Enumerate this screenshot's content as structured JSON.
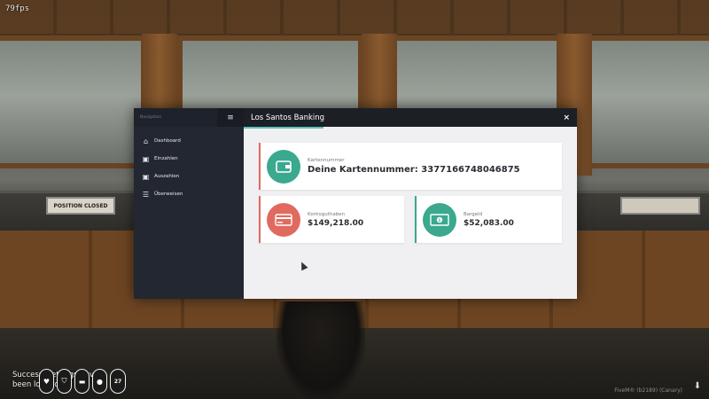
{
  "hud": {
    "fps": "79fps",
    "notification": "Success, settings have been loaded",
    "status_icons": [
      "heart-icon",
      "shield-icon",
      "burger-icon",
      "drop-icon"
    ],
    "status_number": "27",
    "watermark": "FiveM® (b2189) (Canary)"
  },
  "scene": {
    "sign_text": "POSITION CLOSED"
  },
  "modal": {
    "sidebar_title": "Navigation",
    "menu_icon": "hamburger-icon",
    "nav": [
      {
        "label": "Dashboard",
        "icon": "home-icon"
      },
      {
        "label": "Einzahlen",
        "icon": "money-in-icon"
      },
      {
        "label": "Auszahlen",
        "icon": "money-out-icon"
      },
      {
        "label": "Überweisen",
        "icon": "transfer-icon"
      }
    ],
    "title": "Los Santos Banking",
    "close": "×",
    "card_number": {
      "label": "Kartennummer",
      "value": "Deine Kartennummer: 3377166748046875",
      "icon": "wallet-icon"
    },
    "balance": {
      "label": "Kontoguthaben",
      "value": "$149,218.00",
      "icon": "credit-card-icon"
    },
    "cash": {
      "label": "Bargeld",
      "value": "$52,083.00",
      "icon": "cash-icon"
    }
  },
  "colors": {
    "accent_green": "#3aa98e",
    "accent_red": "#e06a5f",
    "sidebar": "#232731",
    "topbar": "#1c1f26"
  }
}
